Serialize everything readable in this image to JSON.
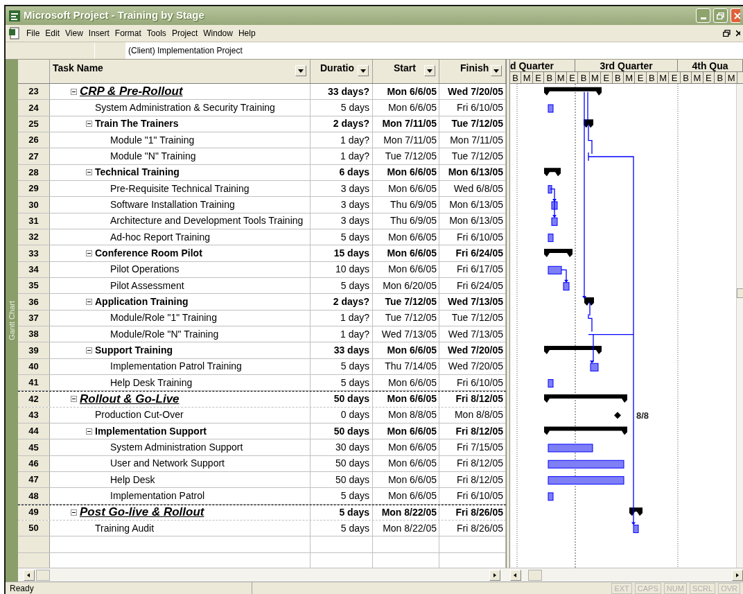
{
  "window": {
    "title": "Microsoft Project - Training  by Stage"
  },
  "menu": [
    "File",
    "Edit",
    "View",
    "Insert",
    "Format",
    "Tools",
    "Project",
    "Window",
    "Help"
  ],
  "entry_bar": {
    "value": "(Client) Implementation Project"
  },
  "view_bar": {
    "label": "Gantt Chart"
  },
  "table": {
    "columns": [
      "Task Name",
      "Duratio",
      "Start",
      "Finish"
    ],
    "rows": [
      {
        "id": "23",
        "name": "CRP & Pre-Rollout",
        "duration": "33 days?",
        "start": "Mon 6/6/05",
        "finish": "Wed 7/20/05",
        "kind": "summary",
        "expanded": true,
        "children": [
          {
            "id": "24",
            "name": "System Administration & Security Training",
            "duration": "5 days",
            "start": "Mon 6/6/05",
            "finish": "Fri 6/10/05",
            "kind": "task"
          },
          {
            "id": "25",
            "name": "Train The Trainers",
            "duration": "2 days?",
            "start": "Mon 7/11/05",
            "finish": "Tue 7/12/05",
            "kind": "summary",
            "expanded": true,
            "children": [
              {
                "id": "26",
                "name": "Module \"1\" Training",
                "duration": "1 day?",
                "start": "Mon 7/11/05",
                "finish": "Mon 7/11/05",
                "kind": "task"
              },
              {
                "id": "27",
                "name": "Module \"N\" Training",
                "duration": "1 day?",
                "start": "Tue 7/12/05",
                "finish": "Tue 7/12/05",
                "kind": "task"
              }
            ]
          },
          {
            "id": "28",
            "name": "Technical Training",
            "duration": "6 days",
            "start": "Mon 6/6/05",
            "finish": "Mon 6/13/05",
            "kind": "summary",
            "expanded": true,
            "children": [
              {
                "id": "29",
                "name": "Pre-Requisite Technical Training",
                "duration": "3 days",
                "start": "Mon 6/6/05",
                "finish": "Wed 6/8/05",
                "kind": "task"
              },
              {
                "id": "30",
                "name": "Software Installation Training",
                "duration": "3 days",
                "start": "Thu 6/9/05",
                "finish": "Mon 6/13/05",
                "kind": "task"
              },
              {
                "id": "31",
                "name": "Architecture and Development Tools Training",
                "duration": "3 days",
                "start": "Thu 6/9/05",
                "finish": "Mon 6/13/05",
                "kind": "task"
              },
              {
                "id": "32",
                "name": "Ad-hoc Report Training",
                "duration": "5 days",
                "start": "Mon 6/6/05",
                "finish": "Fri 6/10/05",
                "kind": "task"
              }
            ]
          },
          {
            "id": "33",
            "name": "Conference Room Pilot",
            "duration": "15 days",
            "start": "Mon 6/6/05",
            "finish": "Fri 6/24/05",
            "kind": "summary",
            "expanded": true,
            "children": [
              {
                "id": "34",
                "name": "Pilot Operations",
                "duration": "10 days",
                "start": "Mon 6/6/05",
                "finish": "Fri 6/17/05",
                "kind": "task"
              },
              {
                "id": "35",
                "name": "Pilot Assessment",
                "duration": "5 days",
                "start": "Mon 6/20/05",
                "finish": "Fri 6/24/05",
                "kind": "task"
              }
            ]
          },
          {
            "id": "36",
            "name": "Application Training",
            "duration": "2 days?",
            "start": "Tue 7/12/05",
            "finish": "Wed 7/13/05",
            "kind": "summary",
            "expanded": true,
            "children": [
              {
                "id": "37",
                "name": "Module/Role \"1\" Training",
                "duration": "1 day?",
                "start": "Tue 7/12/05",
                "finish": "Tue 7/12/05",
                "kind": "task"
              },
              {
                "id": "38",
                "name": "Module/Role \"N\" Training",
                "duration": "1 day?",
                "start": "Wed 7/13/05",
                "finish": "Wed 7/13/05",
                "kind": "task"
              }
            ]
          },
          {
            "id": "39",
            "name": "Support Training",
            "duration": "33 days",
            "start": "Mon 6/6/05",
            "finish": "Wed 7/20/05",
            "kind": "summary",
            "expanded": true,
            "children": [
              {
                "id": "40",
                "name": "Implementation Patrol Training",
                "duration": "5 days",
                "start": "Thu 7/14/05",
                "finish": "Wed 7/20/05",
                "kind": "task"
              },
              {
                "id": "41",
                "name": "Help Desk Training",
                "duration": "5 days",
                "start": "Mon 6/6/05",
                "finish": "Fri 6/10/05",
                "kind": "task"
              }
            ]
          }
        ]
      },
      {
        "id": "42",
        "name": "Rollout & Go-Live",
        "duration": "50 days",
        "start": "Mon 6/6/05",
        "finish": "Fri 8/12/05",
        "kind": "summary",
        "expanded": true,
        "children": [
          {
            "id": "43",
            "name": "Production Cut-Over",
            "duration": "0 days",
            "start": "Mon 8/8/05",
            "finish": "Mon 8/8/05",
            "kind": "milestone"
          },
          {
            "id": "44",
            "name": "Implementation Support",
            "duration": "50 days",
            "start": "Mon 6/6/05",
            "finish": "Fri 8/12/05",
            "kind": "summary",
            "expanded": true,
            "children": [
              {
                "id": "45",
                "name": "System Administration Support",
                "duration": "30 days",
                "start": "Mon 6/6/05",
                "finish": "Fri 7/15/05",
                "kind": "task"
              },
              {
                "id": "46",
                "name": "User and Network Support",
                "duration": "50 days",
                "start": "Mon 6/6/05",
                "finish": "Fri 8/12/05",
                "kind": "task"
              },
              {
                "id": "47",
                "name": "Help Desk",
                "duration": "50 days",
                "start": "Mon 6/6/05",
                "finish": "Fri 8/12/05",
                "kind": "task"
              },
              {
                "id": "48",
                "name": "Implementation Patrol",
                "duration": "5 days",
                "start": "Mon 6/6/05",
                "finish": "Fri 6/10/05",
                "kind": "task"
              }
            ]
          }
        ]
      },
      {
        "id": "49",
        "name": "Post Go-live & Rollout",
        "duration": "5 days",
        "start": "Mon 8/22/05",
        "finish": "Fri 8/26/05",
        "kind": "summary",
        "expanded": true,
        "children": [
          {
            "id": "50",
            "name": "Training Audit",
            "duration": "5 days",
            "start": "Mon 8/22/05",
            "finish": "Fri 8/26/05",
            "kind": "task"
          }
        ]
      }
    ]
  },
  "timescale": {
    "quarters": [
      "d Quarter",
      "3rd Quarter",
      "4th Qua"
    ],
    "periods": [
      "B",
      "M",
      "E",
      "B",
      "M",
      "E",
      "B",
      "M",
      "E",
      "B",
      "M",
      "E",
      "B",
      "M",
      "E",
      "B",
      "M",
      "E",
      "B",
      "M"
    ]
  },
  "gantt": {
    "milestone_label": "8/8"
  },
  "status_bar": {
    "text": "Ready",
    "indicators": [
      {
        "label": "EXT",
        "on": false
      },
      {
        "label": "CAPS",
        "on": false
      },
      {
        "label": "NUM",
        "on": false
      },
      {
        "label": "SCRL",
        "on": false
      },
      {
        "label": "OVR",
        "on": false
      }
    ]
  }
}
